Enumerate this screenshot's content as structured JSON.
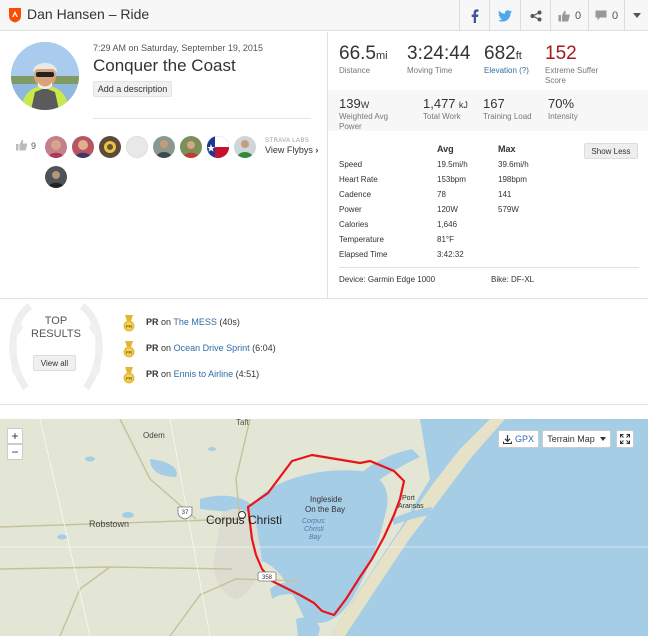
{
  "header": {
    "title": "Dan Hansen – Ride",
    "kudos_count": "0",
    "comment_count": "0"
  },
  "activity": {
    "date_line": "7:29 AM on Saturday, September 19, 2015",
    "title": "Conquer the Coast",
    "add_description": "Add a description"
  },
  "kudos": {
    "count": "9",
    "labs_label": "STRAVA LABS",
    "flyby_label": "View Flybys"
  },
  "primary_stats": [
    {
      "value": "66.5",
      "unit": "mi",
      "label": "Distance"
    },
    {
      "value": "3:24:44",
      "unit": "",
      "label": "Moving Time"
    },
    {
      "value": "682",
      "unit": "ft",
      "label": "Elevation (?)"
    },
    {
      "value": "152",
      "unit": "",
      "label": "Extreme Suffer Score"
    }
  ],
  "secondary_stats": [
    {
      "value": "139",
      "unit": "W",
      "label": "Weighted Avg Power"
    },
    {
      "value": "1,477",
      "unit": "kJ",
      "label": "Total Work"
    },
    {
      "value": "167",
      "unit": "",
      "label": "Training Load"
    },
    {
      "value": "70%",
      "unit": "",
      "label": "Intensity"
    }
  ],
  "details": {
    "avg_header": "Avg",
    "max_header": "Max",
    "show_less": "Show Less",
    "rows": [
      {
        "label": "Speed",
        "avg": "19.5mi/h",
        "max": "39.6mi/h"
      },
      {
        "label": "Heart Rate",
        "avg": "153bpm",
        "max": "198bpm"
      },
      {
        "label": "Cadence",
        "avg": "78",
        "max": "141"
      },
      {
        "label": "Power",
        "avg": "120W",
        "max": "579W"
      },
      {
        "label": "Calories",
        "avg": "1,646",
        "max": ""
      },
      {
        "label": "Temperature",
        "avg": "81°F",
        "max": ""
      },
      {
        "label": "Elapsed Time",
        "avg": "3:42:32",
        "max": ""
      }
    ],
    "device": "Device: Garmin Edge 1000",
    "bike": "Bike: DF-XL"
  },
  "top_results": {
    "title_1": "TOP",
    "title_2": "RESULTS",
    "view_all": "View all",
    "items": [
      {
        "badge": "PR",
        "on": "on",
        "segment": "The MESS",
        "time": "(40s)"
      },
      {
        "badge": "PR",
        "on": "on",
        "segment": "Ocean Drive Sprint",
        "time": "(6:04)"
      },
      {
        "badge": "PR",
        "on": "on",
        "segment": "Ennis to Airline",
        "time": "(4:51)"
      }
    ]
  },
  "map": {
    "zoom_in": "+",
    "zoom_out": "−",
    "gpx_label": "GPX",
    "map_type": "Terrain Map",
    "labels": {
      "taft": "Taft",
      "odem": "Odem",
      "robstown": "Robstown",
      "corpus": "Corpus Christi",
      "ingleside": "Ingleside",
      "onthebay": "On the Bay",
      "bay1": "Corpus",
      "bay2": "Christi",
      "bay3": "Bay",
      "port": "Port",
      "aransas": "Aransas",
      "hwy37": "37",
      "hwy358": "358"
    }
  },
  "colors": {
    "strava_orange": "#fc4c02",
    "suffer_red": "#a5191c",
    "link_blue": "#2f6ca8",
    "route_red": "#e8141c",
    "water": "#a5cde6",
    "land": "#e3e6d4"
  }
}
